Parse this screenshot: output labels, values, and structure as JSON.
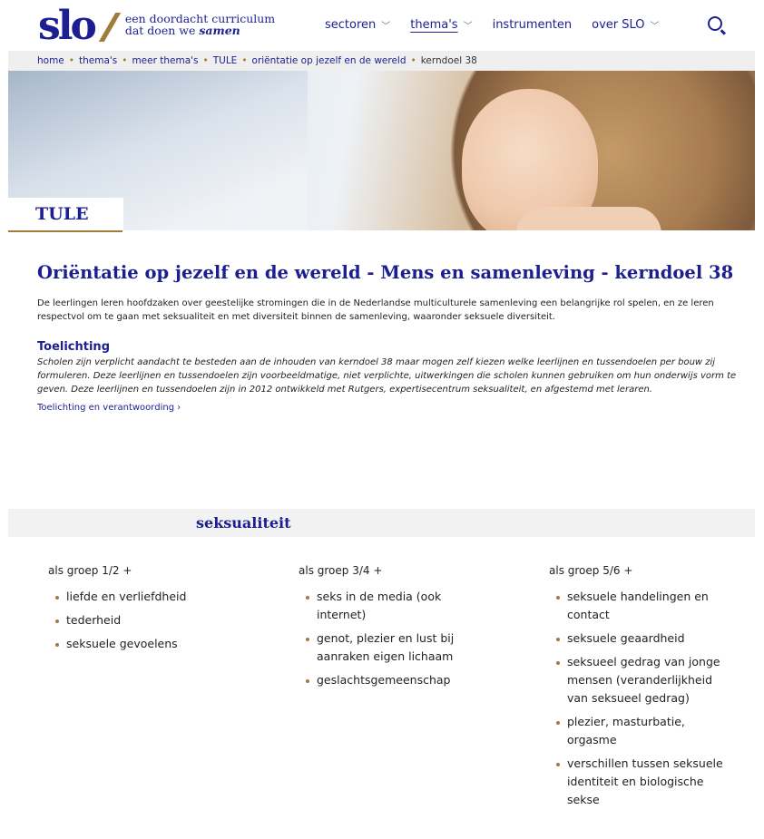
{
  "header": {
    "logo_text": "slo",
    "tagline_line1": "een doordacht curriculum",
    "tagline_line2_prefix": "dat doen we ",
    "tagline_line2_emph": "samen",
    "nav": [
      {
        "label": "sectoren",
        "has_dropdown": true
      },
      {
        "label": "thema's",
        "has_dropdown": true,
        "active": true
      },
      {
        "label": "instrumenten",
        "has_dropdown": false
      },
      {
        "label": "over SLO",
        "has_dropdown": true
      }
    ],
    "search_icon": "search-icon"
  },
  "breadcrumb": {
    "items": [
      "home",
      "thema's",
      "meer thema's",
      "TULE",
      "oriëntatie op jezelf en de wereld"
    ],
    "current": "kerndoel 38",
    "separator": "•"
  },
  "hero": {
    "tag": "TULE"
  },
  "main": {
    "title": "Oriëntatie op jezelf en de wereld - Mens en samenleving - kerndoel 38",
    "intro": "De leerlingen leren hoofdzaken over geestelijke stromingen die in de Nederlandse multiculturele samenleving een belangrijke rol spelen, en ze leren respectvol om te gaan met seksualiteit en met diversiteit binnen de samenleving, waaronder seksuele diversiteit.",
    "toelichting_heading": "Toelichting",
    "toelichting_text": "Scholen zijn verplicht aandacht te besteden aan de inhouden van kerndoel 38 maar mogen zelf kiezen welke leerlijnen en tussendoelen per bouw zij formuleren. Deze leerlijnen en tussendoelen zijn voorbeeldmatige, niet verplichte, uitwerkingen die scholen kunnen gebruiken om hun onderwijs vorm te geven. Deze leerlijnen en tussendoelen zijn in 2012 ontwikkeld met Rutgers, expertisecentrum seksualiteit, en afgestemd met leraren.",
    "toelichting_link": "Toelichting en verantwoording"
  },
  "section": {
    "title": "seksualiteit",
    "columns": [
      {
        "heading": "als groep 1/2 +",
        "items": [
          "liefde en verliefdheid",
          "tederheid",
          "seksuele gevoelens"
        ]
      },
      {
        "heading": "als groep 3/4 +",
        "items": [
          "seks in de media (ook internet)",
          "genot, plezier en lust bij aanraken eigen lichaam",
          "geslachtsgemeenschap"
        ]
      },
      {
        "heading": "als groep 5/6 +",
        "items": [
          "seksuele handelingen en contact",
          "seksuele geaardheid",
          "seksueel gedrag van jonge mensen (veranderlijkheid van seksueel gedrag)",
          "plezier, masturbatie, orgasme",
          "verschillen tussen seksuele identiteit en biologische sekse"
        ]
      }
    ]
  },
  "colors": {
    "brand_blue": "#1b1f8f",
    "accent_gold": "#a07c3b",
    "breadcrumb_bg": "#efefef",
    "section_bg": "#f2f2f2"
  }
}
